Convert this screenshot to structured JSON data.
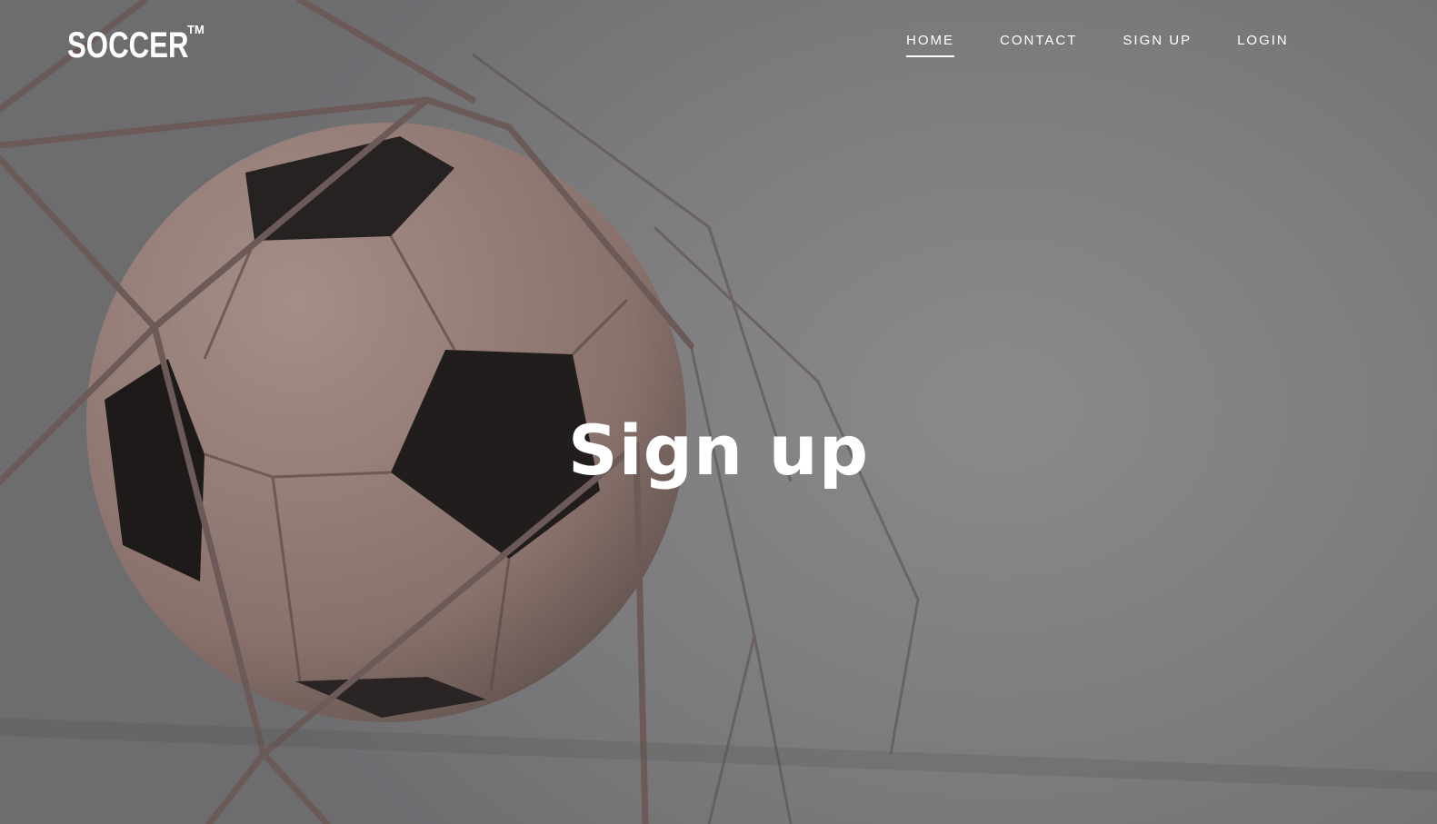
{
  "header": {
    "logo": "SOCCER",
    "logo_mark": "TM",
    "nav": [
      {
        "label": "HOME",
        "active": true
      },
      {
        "label": "CONTACT",
        "active": false
      },
      {
        "label": "SIGN UP",
        "active": false
      },
      {
        "label": "LOGIN",
        "active": false
      }
    ]
  },
  "hero": {
    "title": "Sign up"
  },
  "colors": {
    "text": "#ffffff",
    "overlay": "#7a7a7c"
  }
}
